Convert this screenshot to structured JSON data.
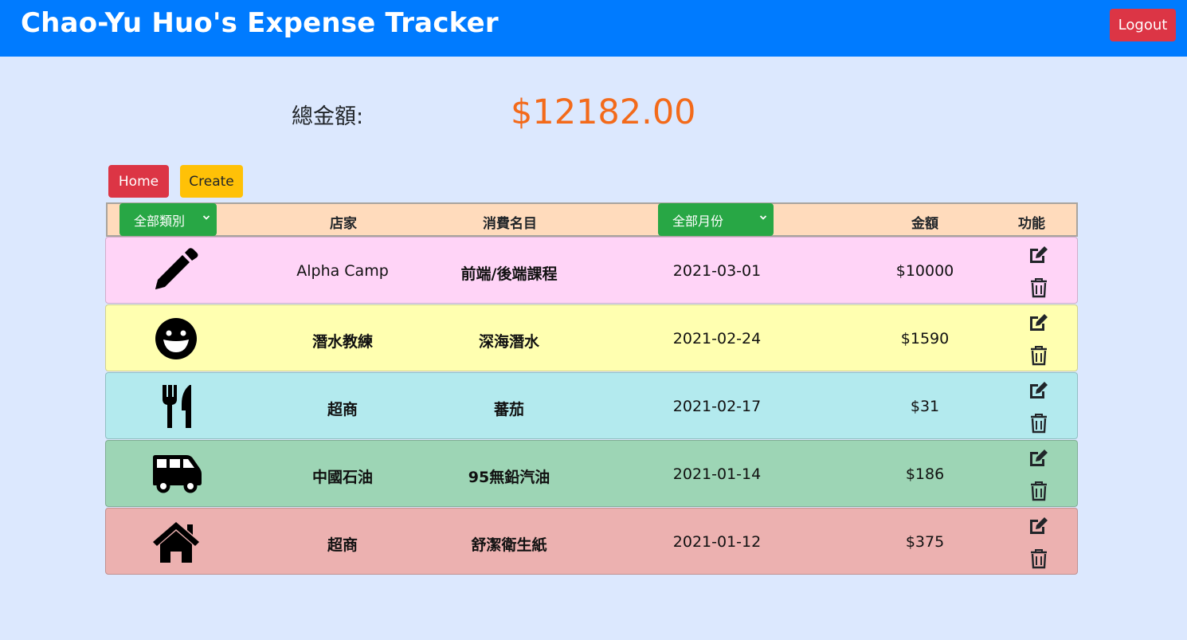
{
  "header": {
    "title": "Chao-Yu Huo's Expense Tracker",
    "logout_label": "Logout"
  },
  "summary": {
    "label": "總金額:",
    "amount": "$12182.00"
  },
  "actions": {
    "home_label": "Home",
    "create_label": "Create"
  },
  "table": {
    "category_filter": {
      "selected": "全部類別"
    },
    "month_filter": {
      "selected": "全部月份"
    },
    "columns": {
      "merchant": "店家",
      "item": "消費名目",
      "amount": "金額",
      "functions": "功能"
    },
    "rows": [
      {
        "category_icon": "pencil-icon",
        "merchant": "Alpha Camp",
        "item": "前端/後端課程",
        "date": "2021-03-01",
        "amount": "$10000",
        "color": "#ffd4f7"
      },
      {
        "category_icon": "grin-face-icon",
        "merchant": "潛水教練",
        "item": "深海潛水",
        "date": "2021-02-24",
        "amount": "$1590",
        "color": "#ffffb0"
      },
      {
        "category_icon": "utensils-icon",
        "merchant": "超商",
        "item": "蕃茄",
        "date": "2021-02-17",
        "amount": "$31",
        "color": "#b3eaee"
      },
      {
        "category_icon": "shuttle-van-icon",
        "merchant": "中國石油",
        "item": "95無鉛汽油",
        "date": "2021-01-14",
        "amount": "$186",
        "color": "#9dd5b5"
      },
      {
        "category_icon": "home-icon",
        "merchant": "超商",
        "item": "舒潔衛生紙",
        "date": "2021-01-12",
        "amount": "$375",
        "color": "#ecb1b0"
      }
    ]
  },
  "colors": {
    "navbar": "#007bff",
    "background": "#dce8fe",
    "total_amount": "#f36a1a",
    "danger": "#dc3545",
    "warning": "#ffc107",
    "success": "#28a745",
    "table_header": "#ffdbbc"
  }
}
